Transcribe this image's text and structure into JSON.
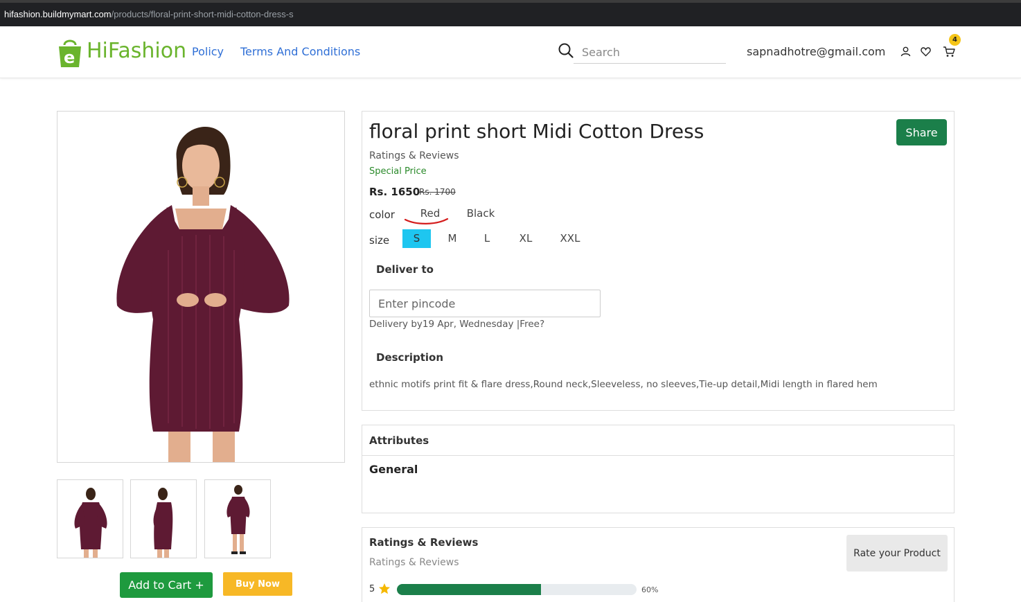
{
  "browser": {
    "url_host": "hifashion.buildmymart.com",
    "url_path": "/products/floral-print-short-midi-cotton-dress-s"
  },
  "header": {
    "brand_prefix": "Hi",
    "brand_suffix": "Fashion",
    "nav": [
      "Policy",
      "Terms And Conditions"
    ],
    "search_placeholder": "Search",
    "user_email": "sapnadhotre@gmail.com",
    "cart_count": "4",
    "icons": [
      "search-icon",
      "user-icon",
      "heart-icon",
      "cart-icon"
    ]
  },
  "product": {
    "title": "floral print short Midi Cotton Dress",
    "share_label": "Share",
    "ratings_label": "Ratings & Reviews",
    "special_label": "Special Price",
    "price": "Rs. 1650",
    "mrp": "Rs. 1700",
    "color_label": "color",
    "colors": [
      "Red",
      "Black"
    ],
    "selected_color": "Red",
    "size_label": "size",
    "sizes": [
      "S",
      "M",
      "L",
      "XL",
      "XXL"
    ],
    "selected_size": "S",
    "deliver_heading": "Deliver to",
    "pincode_placeholder": "Enter pincode",
    "delivery_text": "Delivery by19 Apr, Wednesday |Free?",
    "description_heading": "Description",
    "description": "ethnic motifs print fit & flare dress,Round neck,Sleeveless, no sleeves,Tie-up detail,Midi length in flared hem"
  },
  "actions": {
    "add_to_cart": "Add to Cart +",
    "buy_now": "Buy Now"
  },
  "attributes": {
    "heading": "Attributes",
    "group": "General"
  },
  "ratings": {
    "heading": "Ratings & Reviews",
    "subheading": "Ratings & Reviews",
    "rate_button": "Rate your Product",
    "rows": [
      {
        "stars": "5",
        "percent": 60,
        "percent_label": "60%"
      }
    ]
  },
  "colors": {
    "brand_green": "#6ab42d",
    "nav_blue": "#2f6fd6",
    "share_green": "#1b7f4a",
    "cart_green": "#1e9a3e",
    "buy_orange": "#f7b826",
    "size_selected": "#1ec6f0",
    "dress": "#5e1a33"
  }
}
